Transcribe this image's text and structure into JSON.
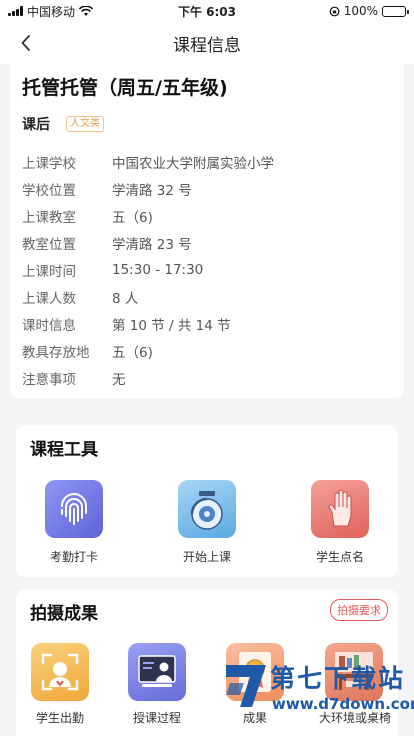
{
  "status_bar": {
    "carrier": "中国移动",
    "time": "下午 6:03",
    "battery_text": "100%",
    "battery_level": 1.0
  },
  "nav": {
    "title": "课程信息"
  },
  "course": {
    "title": "托管托管（周五/五年级)",
    "type": "课后",
    "tag": "人文类",
    "info": [
      {
        "label": "上课学校",
        "value": "中国农业大学附属实验小学"
      },
      {
        "label": "学校位置",
        "value": "学清路 32 号"
      },
      {
        "label": "上课教室",
        "value": "五（6)"
      },
      {
        "label": "教室位置",
        "value": "学清路 23 号"
      },
      {
        "label": "上课时间",
        "value": "15:30 - 17:30"
      },
      {
        "label": "上课人数",
        "value": "8 人"
      },
      {
        "label": "课时信息",
        "value": "第 10 节 / 共 14 节"
      },
      {
        "label": "教具存放地",
        "value": "五（6)"
      },
      {
        "label": "注意事项",
        "value": "无"
      }
    ]
  },
  "tools": {
    "title": "课程工具",
    "items": [
      {
        "label": "考勤打卡",
        "icon": "fingerprint-icon"
      },
      {
        "label": "开始上课",
        "icon": "bell-icon"
      },
      {
        "label": "学生点名",
        "icon": "raised-hand-icon"
      }
    ]
  },
  "photos": {
    "title": "拍摄成果",
    "requirement_label": "拍摄要求",
    "items": [
      {
        "label": "学生出勤",
        "icon": "student-attendance-icon"
      },
      {
        "label": "授课过程",
        "icon": "teaching-process-icon"
      },
      {
        "label": "成果",
        "icon": "medal-icon"
      },
      {
        "label": "大环境或桌椅",
        "icon": "classroom-desk-icon"
      }
    ]
  },
  "watermark": {
    "title": "第七下载站",
    "url": "www.d7down.com"
  },
  "colors": {
    "accent_red": "#e05a5a",
    "tag_orange": "#e6a04b",
    "watermark_blue": "#1e5aa8"
  }
}
